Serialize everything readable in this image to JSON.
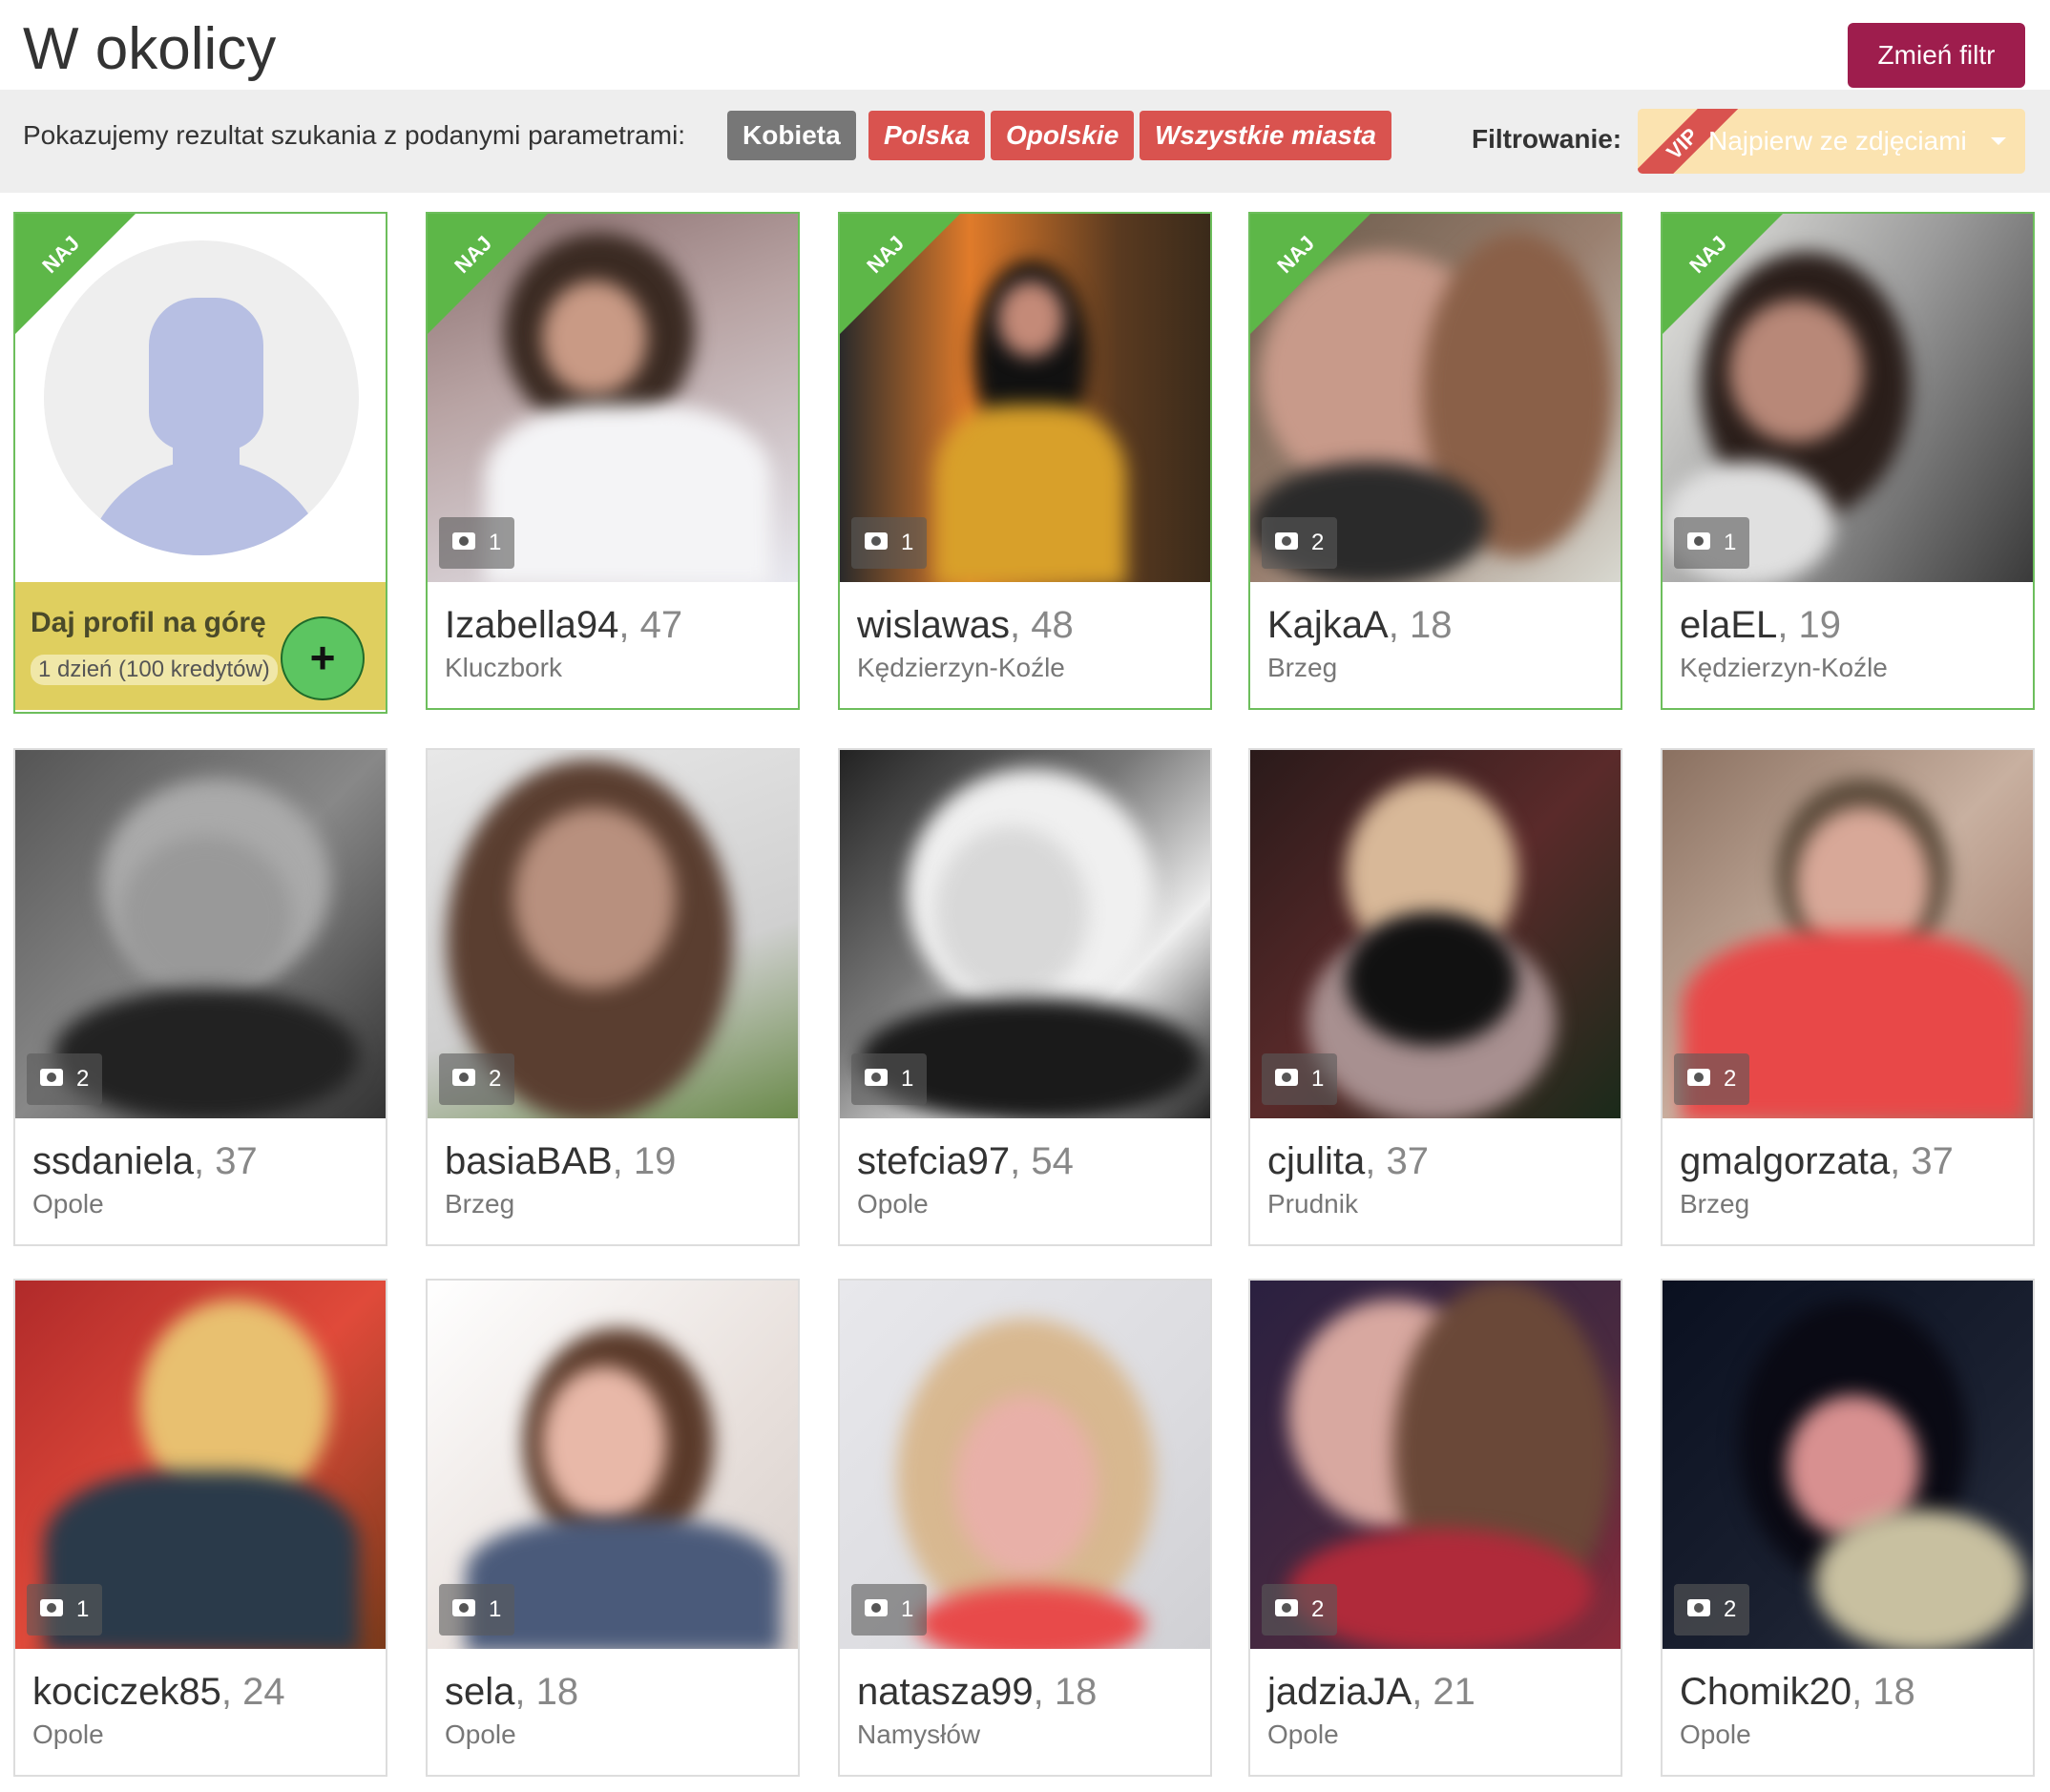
{
  "header": {
    "title": "W okolicy",
    "change_filter_label": "Zmień filtr"
  },
  "filter": {
    "intro": "Pokazujemy rezultat szukania z podanymi parametrami:",
    "tags": [
      "Kobieta",
      "Polska",
      "Opolskie",
      "Wszystkie miasta"
    ],
    "filtering_label": "Filtrowanie:",
    "vip_badge": "VIP",
    "sort_value": "Najpierw ze zdjęciami"
  },
  "promo": {
    "naj_label": "NAJ",
    "title": "Daj profil na górę",
    "subtitle": "1 dzień (100 kredytów)",
    "plus_label": "+"
  },
  "profiles": [
    {
      "name": "Izabella94",
      "age": ", 47",
      "city": "Kluczbork",
      "photos": "1",
      "naj": "NAJ"
    },
    {
      "name": "wislawas",
      "age": ", 48",
      "city": "Kędzierzyn-Koźle",
      "photos": "1",
      "naj": "NAJ"
    },
    {
      "name": "KajkaA",
      "age": ", 18",
      "city": "Brzeg",
      "photos": "2",
      "naj": "NAJ"
    },
    {
      "name": "elaEL",
      "age": ", 19",
      "city": "Kędzierzyn-Koźle",
      "photos": "1",
      "naj": "NAJ"
    },
    {
      "name": "ssdaniela",
      "age": ", 37",
      "city": "Opole",
      "photos": "2"
    },
    {
      "name": "basiaBAB",
      "age": ", 19",
      "city": "Brzeg",
      "photos": "2"
    },
    {
      "name": "stefcia97",
      "age": ", 54",
      "city": "Opole",
      "photos": "1"
    },
    {
      "name": "cjulita",
      "age": ", 37",
      "city": "Prudnik",
      "photos": "1"
    },
    {
      "name": "gmalgorzata",
      "age": ", 37",
      "city": "Brzeg",
      "photos": "2"
    },
    {
      "name": "kociczek85",
      "age": ", 24",
      "city": "Opole",
      "photos": "1"
    },
    {
      "name": "sela",
      "age": ", 18",
      "city": "Opole",
      "photos": "1"
    },
    {
      "name": "natasza99",
      "age": ", 18",
      "city": "Namysłów",
      "photos": "1"
    },
    {
      "name": "jadziaJA",
      "age": ", 21",
      "city": "Opole",
      "photos": "2"
    },
    {
      "name": "Chomik20",
      "age": ", 18",
      "city": "Opole",
      "photos": "2"
    }
  ]
}
